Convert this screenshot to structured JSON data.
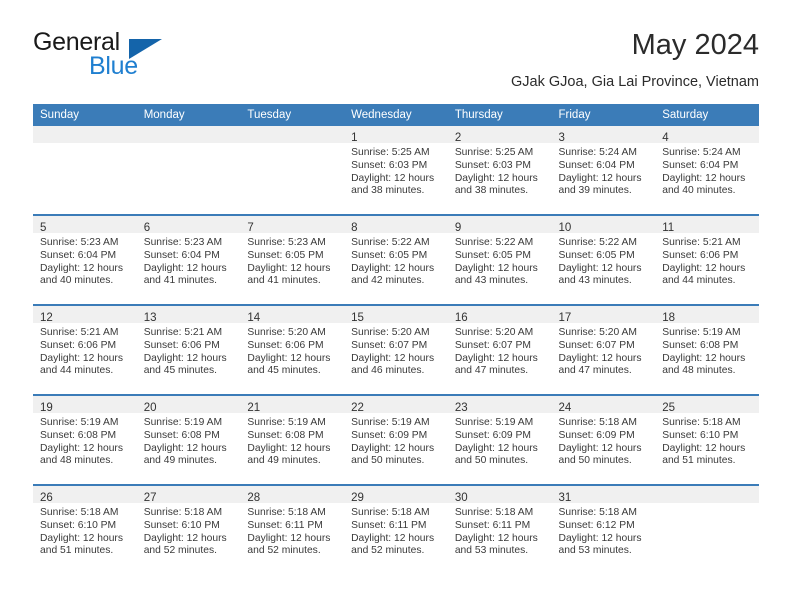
{
  "brand": {
    "line1": "General",
    "line2": "Blue",
    "triangle_color": "#1464aa",
    "blue_color": "#1f7fd0"
  },
  "header": {
    "title": "May 2024",
    "subtitle": "GJak GJoa, Gia Lai Province, Vietnam"
  },
  "theme": {
    "header_row_bg": "#3b7cb8",
    "week_separator": "#3b7cb8",
    "daynum_band_bg": "#f0f0f0",
    "text_color": "#3a3a3a"
  },
  "weekday_headers": [
    "Sunday",
    "Monday",
    "Tuesday",
    "Wednesday",
    "Thursday",
    "Friday",
    "Saturday"
  ],
  "weeks": [
    [
      {
        "day": "",
        "lines": []
      },
      {
        "day": "",
        "lines": []
      },
      {
        "day": "",
        "lines": []
      },
      {
        "day": "1",
        "lines": [
          "Sunrise: 5:25 AM",
          "Sunset: 6:03 PM",
          "Daylight: 12 hours",
          "and 38 minutes."
        ]
      },
      {
        "day": "2",
        "lines": [
          "Sunrise: 5:25 AM",
          "Sunset: 6:03 PM",
          "Daylight: 12 hours",
          "and 38 minutes."
        ]
      },
      {
        "day": "3",
        "lines": [
          "Sunrise: 5:24 AM",
          "Sunset: 6:04 PM",
          "Daylight: 12 hours",
          "and 39 minutes."
        ]
      },
      {
        "day": "4",
        "lines": [
          "Sunrise: 5:24 AM",
          "Sunset: 6:04 PM",
          "Daylight: 12 hours",
          "and 40 minutes."
        ]
      }
    ],
    [
      {
        "day": "5",
        "lines": [
          "Sunrise: 5:23 AM",
          "Sunset: 6:04 PM",
          "Daylight: 12 hours",
          "and 40 minutes."
        ]
      },
      {
        "day": "6",
        "lines": [
          "Sunrise: 5:23 AM",
          "Sunset: 6:04 PM",
          "Daylight: 12 hours",
          "and 41 minutes."
        ]
      },
      {
        "day": "7",
        "lines": [
          "Sunrise: 5:23 AM",
          "Sunset: 6:05 PM",
          "Daylight: 12 hours",
          "and 41 minutes."
        ]
      },
      {
        "day": "8",
        "lines": [
          "Sunrise: 5:22 AM",
          "Sunset: 6:05 PM",
          "Daylight: 12 hours",
          "and 42 minutes."
        ]
      },
      {
        "day": "9",
        "lines": [
          "Sunrise: 5:22 AM",
          "Sunset: 6:05 PM",
          "Daylight: 12 hours",
          "and 43 minutes."
        ]
      },
      {
        "day": "10",
        "lines": [
          "Sunrise: 5:22 AM",
          "Sunset: 6:05 PM",
          "Daylight: 12 hours",
          "and 43 minutes."
        ]
      },
      {
        "day": "11",
        "lines": [
          "Sunrise: 5:21 AM",
          "Sunset: 6:06 PM",
          "Daylight: 12 hours",
          "and 44 minutes."
        ]
      }
    ],
    [
      {
        "day": "12",
        "lines": [
          "Sunrise: 5:21 AM",
          "Sunset: 6:06 PM",
          "Daylight: 12 hours",
          "and 44 minutes."
        ]
      },
      {
        "day": "13",
        "lines": [
          "Sunrise: 5:21 AM",
          "Sunset: 6:06 PM",
          "Daylight: 12 hours",
          "and 45 minutes."
        ]
      },
      {
        "day": "14",
        "lines": [
          "Sunrise: 5:20 AM",
          "Sunset: 6:06 PM",
          "Daylight: 12 hours",
          "and 45 minutes."
        ]
      },
      {
        "day": "15",
        "lines": [
          "Sunrise: 5:20 AM",
          "Sunset: 6:07 PM",
          "Daylight: 12 hours",
          "and 46 minutes."
        ]
      },
      {
        "day": "16",
        "lines": [
          "Sunrise: 5:20 AM",
          "Sunset: 6:07 PM",
          "Daylight: 12 hours",
          "and 47 minutes."
        ]
      },
      {
        "day": "17",
        "lines": [
          "Sunrise: 5:20 AM",
          "Sunset: 6:07 PM",
          "Daylight: 12 hours",
          "and 47 minutes."
        ]
      },
      {
        "day": "18",
        "lines": [
          "Sunrise: 5:19 AM",
          "Sunset: 6:08 PM",
          "Daylight: 12 hours",
          "and 48 minutes."
        ]
      }
    ],
    [
      {
        "day": "19",
        "lines": [
          "Sunrise: 5:19 AM",
          "Sunset: 6:08 PM",
          "Daylight: 12 hours",
          "and 48 minutes."
        ]
      },
      {
        "day": "20",
        "lines": [
          "Sunrise: 5:19 AM",
          "Sunset: 6:08 PM",
          "Daylight: 12 hours",
          "and 49 minutes."
        ]
      },
      {
        "day": "21",
        "lines": [
          "Sunrise: 5:19 AM",
          "Sunset: 6:08 PM",
          "Daylight: 12 hours",
          "and 49 minutes."
        ]
      },
      {
        "day": "22",
        "lines": [
          "Sunrise: 5:19 AM",
          "Sunset: 6:09 PM",
          "Daylight: 12 hours",
          "and 50 minutes."
        ]
      },
      {
        "day": "23",
        "lines": [
          "Sunrise: 5:19 AM",
          "Sunset: 6:09 PM",
          "Daylight: 12 hours",
          "and 50 minutes."
        ]
      },
      {
        "day": "24",
        "lines": [
          "Sunrise: 5:18 AM",
          "Sunset: 6:09 PM",
          "Daylight: 12 hours",
          "and 50 minutes."
        ]
      },
      {
        "day": "25",
        "lines": [
          "Sunrise: 5:18 AM",
          "Sunset: 6:10 PM",
          "Daylight: 12 hours",
          "and 51 minutes."
        ]
      }
    ],
    [
      {
        "day": "26",
        "lines": [
          "Sunrise: 5:18 AM",
          "Sunset: 6:10 PM",
          "Daylight: 12 hours",
          "and 51 minutes."
        ]
      },
      {
        "day": "27",
        "lines": [
          "Sunrise: 5:18 AM",
          "Sunset: 6:10 PM",
          "Daylight: 12 hours",
          "and 52 minutes."
        ]
      },
      {
        "day": "28",
        "lines": [
          "Sunrise: 5:18 AM",
          "Sunset: 6:11 PM",
          "Daylight: 12 hours",
          "and 52 minutes."
        ]
      },
      {
        "day": "29",
        "lines": [
          "Sunrise: 5:18 AM",
          "Sunset: 6:11 PM",
          "Daylight: 12 hours",
          "and 52 minutes."
        ]
      },
      {
        "day": "30",
        "lines": [
          "Sunrise: 5:18 AM",
          "Sunset: 6:11 PM",
          "Daylight: 12 hours",
          "and 53 minutes."
        ]
      },
      {
        "day": "31",
        "lines": [
          "Sunrise: 5:18 AM",
          "Sunset: 6:12 PM",
          "Daylight: 12 hours",
          "and 53 minutes."
        ]
      },
      {
        "day": "",
        "lines": []
      }
    ]
  ]
}
